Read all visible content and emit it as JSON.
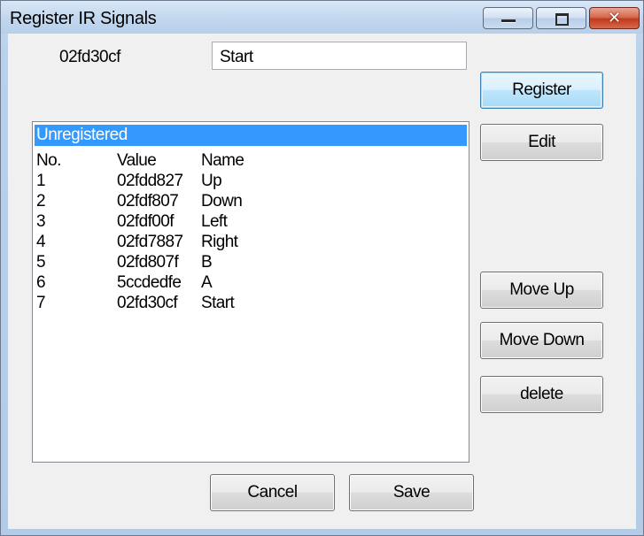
{
  "window": {
    "title": "Register IR Signals",
    "controls": {
      "minimize": "minimize-icon",
      "maximize": "maximize-icon",
      "close": "close-icon"
    }
  },
  "current": {
    "code": "02fd30cf",
    "name_value": "Start"
  },
  "buttons": {
    "register": "Register",
    "edit": "Edit",
    "move_up": "Move Up",
    "move_down": "Move Down",
    "delete": "delete",
    "cancel": "Cancel",
    "save": "Save"
  },
  "list": {
    "group": "Unregistered",
    "columns": {
      "no": "No.",
      "value": "Value",
      "name": "Name"
    },
    "rows": [
      {
        "no": "1",
        "value": "02fdd827",
        "name": "Up"
      },
      {
        "no": "2",
        "value": "02fdf807",
        "name": "Down"
      },
      {
        "no": "3",
        "value": "02fdf00f",
        "name": "Left"
      },
      {
        "no": "4",
        "value": "02fd7887",
        "name": "Right"
      },
      {
        "no": "5",
        "value": "02fd807f",
        "name": "B"
      },
      {
        "no": "6",
        "value": "5ccdedfe",
        "name": "A"
      },
      {
        "no": "7",
        "value": "02fd30cf",
        "name": "Start"
      }
    ]
  },
  "colors": {
    "selection": "#3399ff",
    "close_button": "#c2391d",
    "client_bg": "#f0f0f0"
  }
}
